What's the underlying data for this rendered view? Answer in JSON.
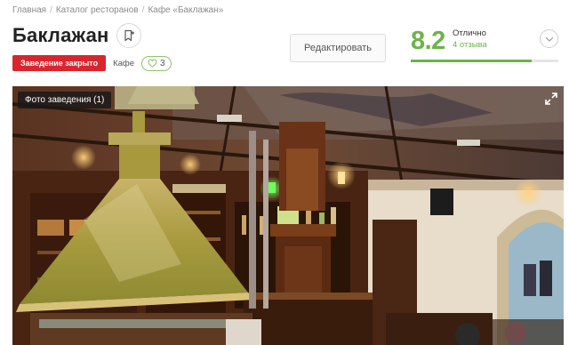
{
  "breadcrumb": {
    "items": [
      "Главная",
      "Каталог ресторанов",
      "Кафе «Баклажан»"
    ],
    "separator": "/"
  },
  "header": {
    "title": "Баклажан",
    "bookmark_icon": "bookmark-plus-icon"
  },
  "status": {
    "closed_label": "Заведение закрыто",
    "closed_color": "#d9262e",
    "type_label": "Кафе",
    "likes_count": "3",
    "like_icon": "heart-icon"
  },
  "actions": {
    "edit_label": "Редактировать"
  },
  "rating": {
    "score": "8.2",
    "score_fraction": 0.82,
    "word": "Отлично",
    "reviews": "4 отзыва",
    "accent_color": "#6cb34a",
    "toggle_icon": "chevron-down-icon"
  },
  "photo": {
    "label": "Фото заведения (1)",
    "expand_icon": "expand-icon"
  }
}
